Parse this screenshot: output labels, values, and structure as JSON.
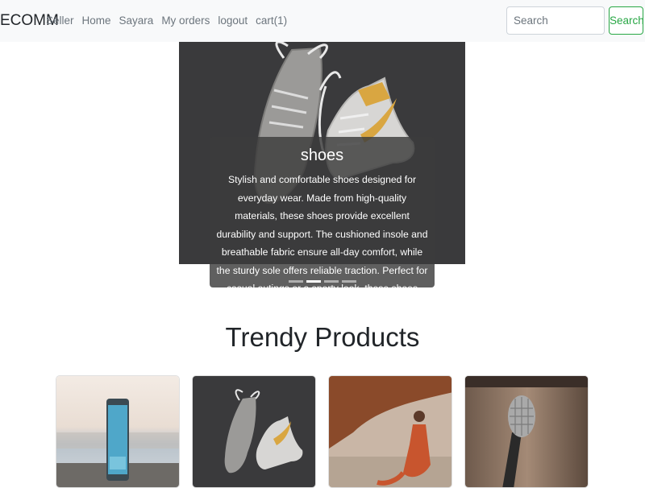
{
  "navbar": {
    "brand": "ECOMM",
    "links": [
      "Seller",
      "Home",
      "Sayara",
      "My orders",
      "logout",
      "cart(1)"
    ],
    "search_placeholder": "Search",
    "search_button": "Search"
  },
  "carousel": {
    "slide_title": "shoes",
    "slide_description": "Stylish and comfortable shoes designed for everyday wear. Made from high-quality materials, these shoes provide excellent durability and support. The cushioned insole and breathable fabric ensure all-day comfort, while the sturdy sole offers reliable traction. Perfect for casual outings or a sporty look, these shoes combine fashion with functionality.",
    "indicator_count": 4,
    "active_indicator": 1
  },
  "trendy": {
    "title": "Trendy Products",
    "products": [
      {
        "image": "smartphone-image"
      },
      {
        "image": "shoes-image"
      },
      {
        "image": "woman-dress-image"
      },
      {
        "image": "microphone-image"
      }
    ]
  },
  "colors": {
    "navbar_bg": "#f8f9fa",
    "search_accent": "#28a745",
    "carousel_bg": "#3a3a3c"
  }
}
